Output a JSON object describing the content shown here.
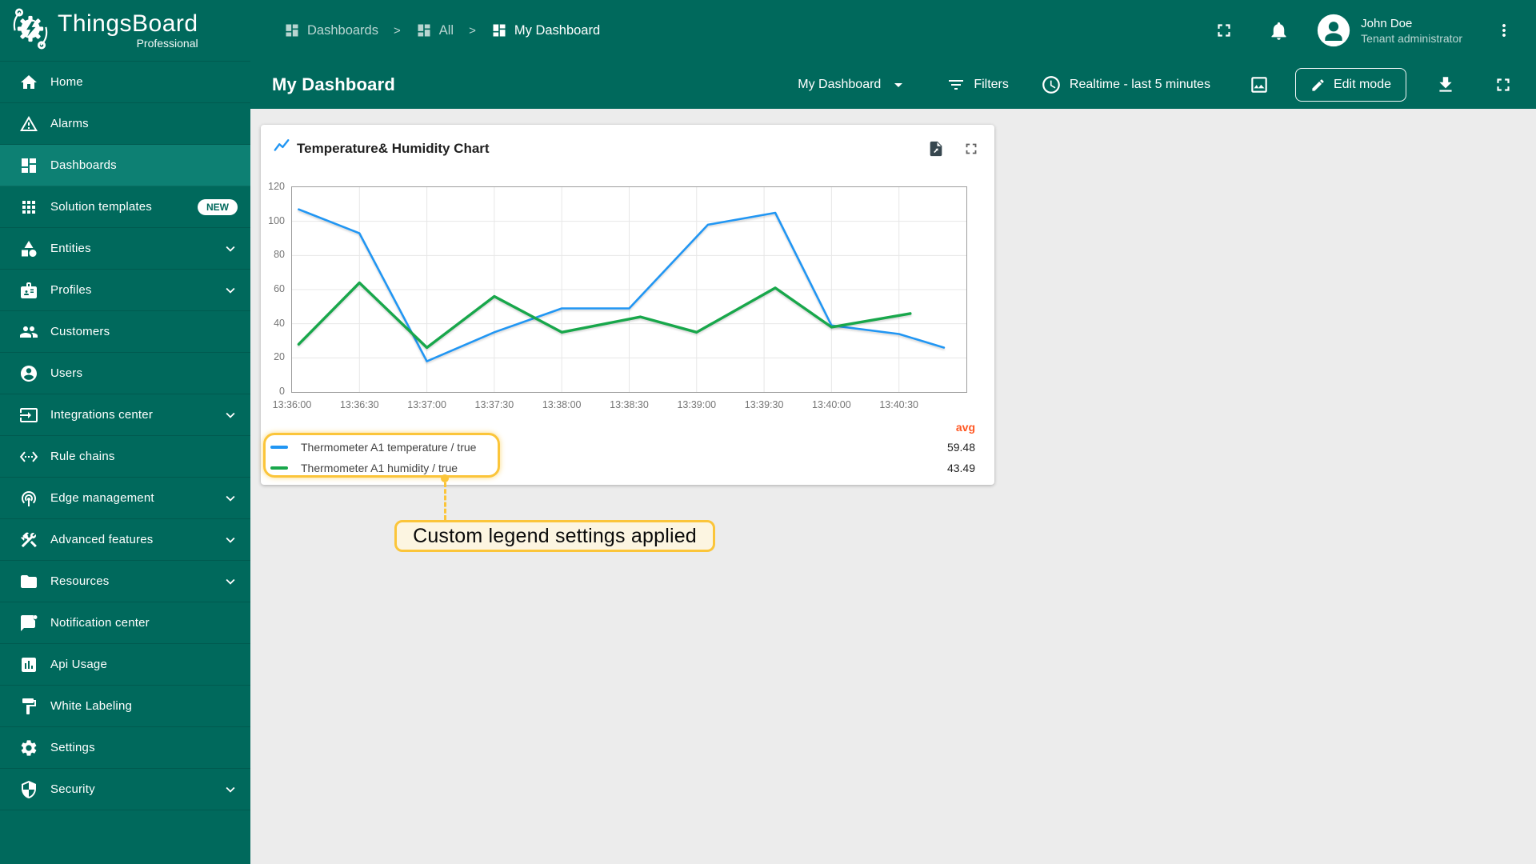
{
  "app": {
    "name": "ThingsBoard",
    "edition": "Professional"
  },
  "topbar": {
    "breadcrumb": [
      {
        "label": "Dashboards",
        "icon": "dashboards",
        "active": false
      },
      {
        "label": "All",
        "icon": "dashboards",
        "active": false
      },
      {
        "label": "My Dashboard",
        "icon": "dashboards",
        "active": true
      }
    ],
    "separator": ">",
    "user": {
      "name": "John Doe",
      "role": "Tenant administrator"
    }
  },
  "toolbar": {
    "title": "My Dashboard",
    "dashboard_select": "My Dashboard",
    "filters_label": "Filters",
    "timewindow_label": "Realtime - last 5 minutes",
    "edit_mode_label": "Edit mode"
  },
  "sidebar": {
    "items": [
      {
        "label": "Home",
        "icon": "home"
      },
      {
        "label": "Alarms",
        "icon": "alarms"
      },
      {
        "label": "Dashboards",
        "icon": "dashboards",
        "selected": true
      },
      {
        "label": "Solution templates",
        "icon": "solution-templates",
        "badge": "NEW"
      },
      {
        "label": "Entities",
        "icon": "entities",
        "expandable": true
      },
      {
        "label": "Profiles",
        "icon": "profiles",
        "expandable": true
      },
      {
        "label": "Customers",
        "icon": "customers"
      },
      {
        "label": "Users",
        "icon": "users"
      },
      {
        "label": "Integrations center",
        "icon": "integrations-center",
        "expandable": true
      },
      {
        "label": "Rule chains",
        "icon": "rule-chains"
      },
      {
        "label": "Edge management",
        "icon": "edge-management",
        "expandable": true
      },
      {
        "label": "Advanced features",
        "icon": "advanced-features",
        "expandable": true
      },
      {
        "label": "Resources",
        "icon": "resources",
        "expandable": true
      },
      {
        "label": "Notification center",
        "icon": "notification-center"
      },
      {
        "label": "Api Usage",
        "icon": "api-usage"
      },
      {
        "label": "White Labeling",
        "icon": "white-labeling"
      },
      {
        "label": "Settings",
        "icon": "settings"
      },
      {
        "label": "Security",
        "icon": "security",
        "expandable": true
      }
    ]
  },
  "widget": {
    "title": "Temperature& Humidity Chart",
    "legend": {
      "avg_label": "avg",
      "items": [
        {
          "label": "Thermometer A1 temperature / true",
          "color": "#2196f3",
          "avg": "59.48"
        },
        {
          "label": "Thermometer A1 humidity / true",
          "color": "#18a74b",
          "avg": "43.49"
        }
      ]
    }
  },
  "annotation": {
    "label": "Custom legend settings applied"
  },
  "colors": {
    "sidebar_teal": "#00695c",
    "selected_item": "#0d8073",
    "canvas_gray": "#ececec",
    "highlight_yellow": "#fbc53a",
    "avg_orange": "#ff5722",
    "temperature_blue": "#2196f3",
    "humidity_green": "#18a74b"
  },
  "chart_data": {
    "type": "line",
    "title": "Temperature& Humidity Chart",
    "ylim": [
      0,
      120
    ],
    "y_ticks": [
      0,
      20,
      40,
      60,
      80,
      100,
      120
    ],
    "x_duration_seconds": 300,
    "x_ticks": [
      {
        "sec": 0,
        "label": "13:36:00"
      },
      {
        "sec": 30,
        "label": "13:36:30"
      },
      {
        "sec": 60,
        "label": "13:37:00"
      },
      {
        "sec": 90,
        "label": "13:37:30"
      },
      {
        "sec": 120,
        "label": "13:38:00"
      },
      {
        "sec": 150,
        "label": "13:38:30"
      },
      {
        "sec": 180,
        "label": "13:39:00"
      },
      {
        "sec": 210,
        "label": "13:39:30"
      },
      {
        "sec": 240,
        "label": "13:40:00"
      },
      {
        "sec": 270,
        "label": "13:40:30"
      }
    ],
    "grid": true,
    "legend_position": "bottom",
    "series": [
      {
        "name": "Thermometer A1 temperature / true",
        "color": "#2196f3",
        "avg": 59.48,
        "points": [
          [
            3,
            107
          ],
          [
            30,
            93
          ],
          [
            60,
            18
          ],
          [
            90,
            35
          ],
          [
            120,
            49
          ],
          [
            150,
            49
          ],
          [
            185,
            98
          ],
          [
            215,
            105
          ],
          [
            240,
            39
          ],
          [
            270,
            34
          ],
          [
            290,
            26
          ]
        ]
      },
      {
        "name": "Thermometer A1 humidity / true",
        "color": "#18a74b",
        "avg": 43.49,
        "points": [
          [
            3,
            28
          ],
          [
            30,
            64
          ],
          [
            60,
            26
          ],
          [
            90,
            56
          ],
          [
            120,
            35
          ],
          [
            155,
            44
          ],
          [
            180,
            35
          ],
          [
            215,
            61
          ],
          [
            240,
            38
          ],
          [
            275,
            46
          ]
        ]
      }
    ]
  }
}
